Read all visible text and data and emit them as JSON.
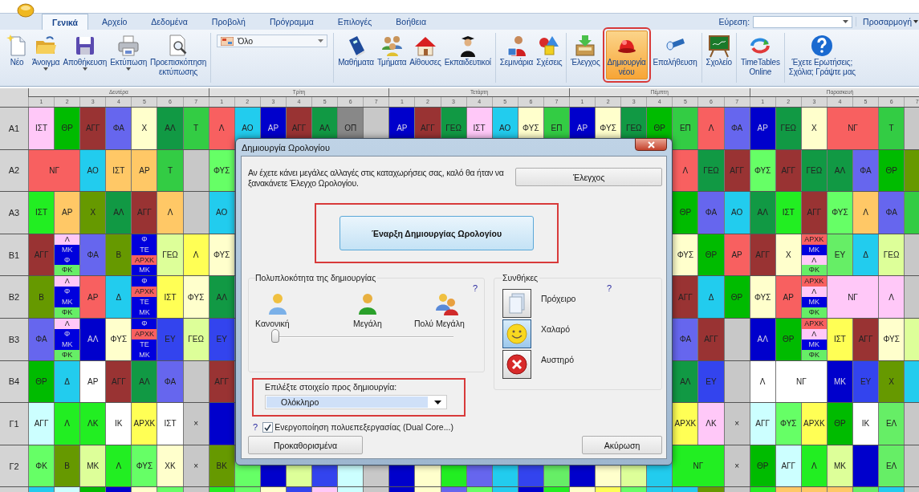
{
  "tabs": [
    {
      "label": "Γενικά",
      "selected": true
    },
    {
      "label": "Αρχείο",
      "selected": false
    },
    {
      "label": "Δεδομένα",
      "selected": false
    },
    {
      "label": "Προβολή",
      "selected": false
    },
    {
      "label": "Πρόγραμμα",
      "selected": false
    },
    {
      "label": "Επιλογές",
      "selected": false
    },
    {
      "label": "Βοήθεια",
      "selected": false
    }
  ],
  "search": {
    "label": "Εύρεση:"
  },
  "customize": {
    "label": "Προσαρμογή"
  },
  "ribbon": {
    "groups": [
      {
        "kind": "buttons",
        "buttons": [
          {
            "lines": [
              "Νέο"
            ],
            "menu": false,
            "highlighted": false
          },
          {
            "lines": [
              "Άνοιγμα"
            ],
            "menu": true,
            "highlighted": false
          },
          {
            "lines": [
              "Αποθήκευση"
            ],
            "menu": true,
            "highlighted": false
          },
          {
            "lines": [
              "Εκτύπωση"
            ],
            "menu": true,
            "highlighted": false
          },
          {
            "lines": [
              "Προεπισκόπηση",
              "εκτύπωσης"
            ],
            "menu": false,
            "highlighted": false
          }
        ]
      },
      {
        "kind": "combo",
        "value": "Όλο"
      },
      {
        "kind": "buttons",
        "buttons": [
          {
            "lines": [
              "Μαθήματα"
            ],
            "menu": false,
            "highlighted": false
          },
          {
            "lines": [
              "Τμήματα"
            ],
            "menu": false,
            "highlighted": false
          },
          {
            "lines": [
              "Αίθουσες"
            ],
            "menu": false,
            "highlighted": false
          },
          {
            "lines": [
              "Εκπαιδευτικοί"
            ],
            "menu": false,
            "highlighted": false
          }
        ]
      },
      {
        "kind": "buttons",
        "buttons": [
          {
            "lines": [
              "Σεμινάρια"
            ],
            "menu": false,
            "highlighted": false
          },
          {
            "lines": [
              "Σχέσεις"
            ],
            "menu": false,
            "highlighted": false
          }
        ]
      },
      {
        "kind": "buttons",
        "buttons": [
          {
            "lines": [
              "Έλεγχος"
            ],
            "menu": false,
            "highlighted": false
          },
          {
            "lines": [
              "Δημιουργία",
              "νέου"
            ],
            "menu": false,
            "highlighted": true
          },
          {
            "lines": [
              "Επαλήθευση"
            ],
            "menu": false,
            "highlighted": false
          }
        ]
      },
      {
        "kind": "buttons",
        "buttons": [
          {
            "lines": [
              "Σχολείο"
            ],
            "menu": false,
            "highlighted": false
          }
        ]
      },
      {
        "kind": "buttons",
        "buttons": [
          {
            "lines": [
              "TimeTables",
              "Online"
            ],
            "menu": false,
            "highlighted": false
          }
        ]
      },
      {
        "kind": "buttons",
        "buttons": [
          {
            "lines": [
              "Έχετε Ερωτήσεις;",
              "Σχόλια; Γράψτε μας"
            ],
            "menu": false,
            "highlighted": false
          }
        ]
      }
    ]
  },
  "timetable": {
    "days": [
      {
        "name": "Δευτέρα",
        "periods": [
          "1",
          "2",
          "3",
          "4",
          "5",
          "6",
          "7"
        ]
      },
      {
        "name": "Τρίτη",
        "periods": [
          "1",
          "2",
          "3",
          "4",
          "5",
          "6",
          "7"
        ]
      },
      {
        "name": "Τετάρτη",
        "periods": [
          "1",
          "2",
          "3",
          "4",
          "5",
          "6",
          "7"
        ]
      },
      {
        "name": "Πέμπτη",
        "periods": [
          "1",
          "2",
          "3",
          "4",
          "5",
          "6",
          "7"
        ]
      },
      {
        "name": "Παρασκευή",
        "periods": [
          "1",
          "2",
          "3",
          "4",
          "5",
          "6",
          "7"
        ]
      }
    ],
    "rows": [
      {
        "label": "Α1",
        "cells": [
          {
            "text": "ΙΣΤ",
            "color": "#ffc8f8"
          },
          {
            "text": "ΘΡ",
            "color": "#00bb00"
          },
          {
            "text": "ΑΓΓ",
            "color": "#993333"
          },
          {
            "text": "ΦΑ",
            "color": "#6666ee"
          },
          {
            "text": "Χ",
            "color": "#ffffcc"
          },
          {
            "text": "ΑΛ",
            "color": "#119944"
          },
          {
            "text": "Τ",
            "color": "#33cc44"
          },
          {
            "text": "Λ",
            "color": "#f86060"
          },
          {
            "text": "ΑΟ",
            "color": "#22ccee"
          },
          {
            "text": "ΑΡ",
            "color": "#0000cc"
          },
          {
            "text": "ΑΓΓ",
            "color": "#993333"
          },
          {
            "text": "ΑΛ",
            "color": "#119944"
          },
          {
            "text": "ΟΠ",
            "color": "#888888"
          },
          {
            "color": "#c8c8c8"
          },
          {
            "text": "ΑΡ",
            "color": "#0000cc"
          },
          {
            "text": "ΑΓΓ",
            "color": "#993333"
          },
          {
            "text": "ΓΕΩ",
            "color": "#119944"
          },
          {
            "text": "ΙΣΤ",
            "color": "#ffc8f8"
          },
          {
            "text": "ΑΟ",
            "color": "#22ccee"
          },
          {
            "text": "ΦΥΣ",
            "color": "#ffffcc"
          },
          {
            "text": "ΕΠ",
            "color": "#33cc44"
          },
          {
            "text": "ΑΡ",
            "color": "#0000cc"
          },
          {
            "text": "ΦΥΣ",
            "color": "#ffffcc"
          },
          {
            "text": "ΓΕΩ",
            "color": "#119944"
          },
          {
            "text": "ΘΡ",
            "color": "#00bb00"
          },
          {
            "text": "ΕΠ",
            "color": "#33cc44"
          },
          {
            "text": "Λ",
            "color": "#f86060"
          },
          {
            "text": "ΦΑ",
            "color": "#6666ee"
          },
          {
            "text": "ΑΡ",
            "color": "#0000cc"
          },
          {
            "text": "ΓΕΩ",
            "color": "#119944"
          },
          {
            "text": "Χ",
            "color": "#ffffcc"
          },
          {
            "text": "ΝΓ",
            "color": "#f86060"
          },
          "",
          {
            "text": "Τ",
            "color": "#33cc44"
          },
          {
            "color": "#c8c8c8"
          }
        ]
      },
      {
        "label": "Α2",
        "cells": [
          {
            "text": "ΝΓ",
            "color": "#f86060"
          },
          "",
          {
            "text": "ΑΟ",
            "color": "#22ccee"
          },
          {
            "text": "ΙΣΤ",
            "color": "#ffc866"
          },
          {
            "text": "ΑΡ",
            "color": "#ffc866"
          },
          {
            "text": "Τ",
            "color": "#33cc44"
          },
          {
            "color": "#c8c8c8"
          },
          {
            "text": "ΦΥΣ",
            "color": "#66ff66"
          },
          null,
          null,
          null,
          null,
          null,
          null,
          null,
          null,
          null,
          null,
          null,
          null,
          null,
          null,
          null,
          null,
          null,
          {
            "text": "Λ",
            "color": "#f86060"
          },
          {
            "text": "ΓΕΩ",
            "color": "#119944"
          },
          {
            "text": "ΑΓΓ",
            "color": "#993333"
          },
          {
            "text": "ΦΥΣ",
            "color": "#66ff66"
          },
          {
            "text": "ΑΓΓ",
            "color": "#993333"
          },
          {
            "text": "ΓΕΩ",
            "color": "#119944"
          },
          {
            "text": "ΑΛ",
            "color": "#119944"
          },
          {
            "text": "ΦΑ",
            "color": "#6666ee"
          },
          {
            "text": "ΘΡ",
            "color": "#00bb00"
          },
          {
            "color": "#669900"
          }
        ]
      },
      {
        "label": "Α3",
        "cells": [
          {
            "text": "ΙΣΤ",
            "color": "#22ee22"
          },
          {
            "text": "ΑΡ",
            "color": "#ffc866"
          },
          {
            "text": "Χ",
            "color": "#669900"
          },
          {
            "text": "ΑΛ",
            "color": "#119944"
          },
          {
            "text": "ΑΓΓ",
            "color": "#993333"
          },
          {
            "text": "Λ",
            "color": "#ffc866"
          },
          {
            "color": "#c8c8c8"
          },
          {
            "text": "ΑΟ",
            "color": "#22ccee"
          },
          null,
          null,
          null,
          null,
          null,
          null,
          null,
          null,
          null,
          null,
          null,
          null,
          null,
          null,
          null,
          null,
          null,
          {
            "text": "ΘΡ",
            "color": "#00bb00"
          },
          {
            "text": "ΦΑ",
            "color": "#6666ee"
          },
          {
            "text": "ΑΟ",
            "color": "#22ccee"
          },
          {
            "text": "ΑΛ",
            "color": "#119944"
          },
          {
            "text": "ΙΣΤ",
            "color": "#22ee22"
          },
          {
            "text": "ΑΓΓ",
            "color": "#993333"
          },
          {
            "text": "ΦΥΣ",
            "color": "#66ff66"
          },
          {
            "text": "Λ",
            "color": "#ffc866"
          },
          {
            "text": "ΦΑ",
            "color": "#6666ee"
          },
          {
            "color": "#33cc44"
          }
        ]
      },
      {
        "label": "Β1",
        "cells": [
          {
            "text": "ΑΓΓ",
            "color": "#993333"
          },
          {
            "parts": [
              {
                "text": "Λ",
                "color": "#ffc8f8"
              },
              {
                "text": "ΜΚ",
                "color": "#0000dd"
              },
              {
                "text": "Φ",
                "color": "#0000dd"
              },
              {
                "text": "ΦΚ",
                "color": "#66ee66"
              }
            ]
          },
          {
            "text": "ΦΑ",
            "color": "#6666ee"
          },
          {
            "text": "Β",
            "color": "#669900"
          },
          {
            "parts": [
              {
                "text": "Φ",
                "color": "#0000dd"
              },
              {
                "text": "ΤΕ",
                "color": "#0000dd"
              },
              {
                "text": "ΑΡΧΚ",
                "color": "#f86060"
              },
              {
                "text": "ΜΚ",
                "color": "#0000dd"
              }
            ]
          },
          {
            "text": "ΓΕΩ",
            "color": "#ddff99"
          },
          {
            "text": "Λ",
            "color": "#ffff55"
          },
          {
            "text": "ΦΥΣ",
            "color": "#ffffcc"
          },
          null,
          null,
          null,
          null,
          null,
          null,
          null,
          null,
          null,
          null,
          null,
          null,
          null,
          null,
          null,
          null,
          null,
          {
            "text": "ΦΥΣ",
            "color": "#ffffcc"
          },
          {
            "text": "ΘΡ",
            "color": "#00bb00"
          },
          {
            "text": "ΑΡ",
            "color": "#f86060"
          },
          {
            "text": "ΑΓΓ",
            "color": "#993333"
          },
          {
            "text": "Χ",
            "color": "#ffffcc"
          },
          {
            "parts": [
              {
                "text": "ΑΡΧΚ",
                "color": "#f86060"
              },
              {
                "text": "ΜΚ",
                "color": "#0000dd"
              },
              {
                "text": "Λ",
                "color": "#ffc8f8"
              },
              {
                "text": "ΦΚ",
                "color": "#66ee66"
              }
            ]
          },
          {
            "text": "ΕΥ",
            "color": "#66ee66"
          },
          {
            "text": "Δ",
            "color": "#22ccee"
          },
          {
            "text": "ΓΕΩ",
            "color": "#ddff99"
          },
          {
            "color": "#c8c8c8"
          }
        ]
      },
      {
        "label": "Β2",
        "cells": [
          {
            "text": "Β",
            "color": "#669900"
          },
          {
            "parts": [
              {
                "text": "Λ",
                "color": "#ffc8f8"
              },
              {
                "text": "Φ",
                "color": "#0000dd"
              },
              {
                "text": "ΜΚ",
                "color": "#0000dd"
              },
              {
                "text": "ΦΚ",
                "color": "#66ee66"
              }
            ]
          },
          {
            "text": "ΑΡ",
            "color": "#f86060"
          },
          {
            "text": "Δ",
            "color": "#22ccee"
          },
          {
            "parts": [
              {
                "text": "Φ",
                "color": "#0000dd"
              },
              {
                "text": "ΑΡΧΚ",
                "color": "#f86060"
              },
              {
                "text": "ΤΕ",
                "color": "#0000dd"
              },
              {
                "text": "ΜΚ",
                "color": "#0000dd"
              }
            ]
          },
          {
            "text": "ΙΣΤ",
            "color": "#ffff55"
          },
          {
            "text": "ΦΥΣ",
            "color": "#ffffcc"
          },
          {
            "text": "ΑΛ",
            "color": "#119944"
          },
          null,
          null,
          null,
          null,
          null,
          null,
          null,
          null,
          null,
          null,
          null,
          null,
          null,
          null,
          null,
          null,
          null,
          {
            "text": "ΑΓΓ",
            "color": "#993333"
          },
          {
            "text": "Δ",
            "color": "#22ccee"
          },
          {
            "text": "ΘΡ",
            "color": "#00bb00"
          },
          {
            "text": "ΦΥΣ",
            "color": "#ffffcc"
          },
          {
            "text": "ΑΡ",
            "color": "#f86060"
          },
          {
            "parts": [
              {
                "text": "ΑΡΧΚ",
                "color": "#f86060"
              },
              {
                "text": "Λ",
                "color": "#ffc8f8"
              },
              {
                "text": "ΜΚ",
                "color": "#0000dd"
              },
              {
                "text": "ΦΚ",
                "color": "#66ee66"
              }
            ]
          },
          {
            "text": "ΝΓ",
            "color": "#ffc8f8"
          },
          "",
          {
            "text": "Λ",
            "color": "#ffc8f8"
          },
          {
            "color": "#c8c8c8"
          }
        ]
      },
      {
        "label": "Β3",
        "cells": [
          {
            "text": "ΦΑ",
            "color": "#6666ee"
          },
          {
            "parts": [
              {
                "text": "Λ",
                "color": "#ffc8f8"
              },
              {
                "text": "Φ",
                "color": "#0000dd"
              },
              {
                "text": "ΜΚ",
                "color": "#0000dd"
              },
              {
                "text": "ΦΚ",
                "color": "#66ee66"
              }
            ]
          },
          {
            "text": "ΑΛ",
            "color": "#0000cc"
          },
          {
            "text": "ΦΥΣ",
            "color": "#ffffcc"
          },
          {
            "parts": [
              {
                "text": "Φ",
                "color": "#0000dd"
              },
              {
                "text": "ΑΡΧΚ",
                "color": "#f86060"
              },
              {
                "text": "ΤΕ",
                "color": "#0000dd"
              },
              {
                "text": "ΜΚ",
                "color": "#0000dd"
              }
            ]
          },
          {
            "text": "ΕΥ",
            "color": "#3344ee"
          },
          {
            "text": "ΓΕΩ",
            "color": "#ddff99"
          },
          {
            "text": "ΕΥ",
            "color": "#3344ee"
          },
          null,
          null,
          null,
          null,
          null,
          null,
          null,
          null,
          null,
          null,
          null,
          null,
          null,
          null,
          null,
          null,
          null,
          {
            "text": "ΦΑ",
            "color": "#6666ee"
          },
          {
            "text": "ΑΓΓ",
            "color": "#993333"
          },
          {
            "color": "#c8c8c8"
          },
          {
            "text": "ΑΛ",
            "color": "#0000cc"
          },
          {
            "text": "ΘΡ",
            "color": "#00bb00"
          },
          {
            "parts": [
              {
                "text": "ΑΡΧΚ",
                "color": "#f86060"
              },
              {
                "text": "Λ",
                "color": "#ffc8f8"
              },
              {
                "text": "ΜΚ",
                "color": "#0000dd"
              },
              {
                "text": "ΦΚ",
                "color": "#66ee66"
              }
            ]
          },
          {
            "text": "ΙΣΤ",
            "color": "#ffff55"
          },
          {
            "text": "ΑΓΓ",
            "color": "#993333"
          },
          {
            "text": "ΦΥΣ",
            "color": "#ffffcc"
          },
          {
            "color": "#ddff99"
          }
        ]
      },
      {
        "label": "Β4",
        "cells": [
          {
            "text": "ΘΡ",
            "color": "#00bb00"
          },
          {
            "text": "Δ",
            "color": "#22ccee"
          },
          {
            "text": "ΑΡ",
            "color": "#ffffff"
          },
          {
            "text": "ΑΓΓ",
            "color": "#993333"
          },
          {
            "text": "ΑΛ",
            "color": "#119944"
          },
          {
            "text": "ΦΑ",
            "color": "#6666ee"
          },
          {
            "color": "#c8c8c8"
          },
          {
            "text": "ΑΓΓ",
            "color": "#993333"
          },
          null,
          null,
          null,
          null,
          null,
          null,
          null,
          null,
          null,
          null,
          null,
          null,
          null,
          null,
          null,
          null,
          null,
          {
            "text": "ΑΛ",
            "color": "#119944"
          },
          {
            "text": "ΕΥ",
            "color": "#3344ee"
          },
          {
            "color": "#c8c8c8"
          },
          {
            "text": "Λ",
            "color": "#ffffff"
          },
          {
            "text": "ΝΓ",
            "color": "#ffffff"
          },
          "",
          {
            "text": "ΜΚ",
            "color": "#0000cc"
          },
          {
            "text": "ΕΥ",
            "color": "#3344ee"
          },
          {
            "text": "Χ",
            "color": "#669900"
          },
          {
            "color": "#22ccee"
          }
        ]
      },
      {
        "label": "Γ1",
        "cells": [
          {
            "text": "ΑΓΓ",
            "color": "#ccffff"
          },
          {
            "text": "Λ",
            "color": "#22ee22"
          },
          {
            "text": "ΛΚ",
            "color": "#22ee22"
          },
          {
            "text": "ΙΚ",
            "color": "#ffffff"
          },
          {
            "text": "ΑΡΧΚ",
            "color": "#ffff55"
          },
          {
            "text": "ΙΣΤ",
            "color": "#ffffff"
          },
          {
            "text": "×",
            "color": "#c8c8c8"
          },
          {
            "color": "#0000cc"
          },
          null,
          null,
          null,
          null,
          null,
          null,
          null,
          null,
          null,
          null,
          null,
          null,
          null,
          null,
          null,
          null,
          null,
          {
            "text": "ΑΡΧΚ",
            "color": "#ffff55"
          },
          {
            "text": "ΛΚ",
            "color": "#ffc8f8"
          },
          {
            "text": "×",
            "color": "#c8c8c8"
          },
          {
            "text": "ΑΓΓ",
            "color": "#ccffff"
          },
          {
            "text": "ΦΥΣ",
            "color": "#66ff66"
          },
          {
            "text": "ΑΡΧΚ",
            "color": "#ffff55"
          },
          {
            "text": "ΘΡ",
            "color": "#00bb00"
          },
          {
            "text": "ΙΚ",
            "color": "#ffffff"
          },
          {
            "text": "ΕΛ",
            "color": "#66ee66"
          },
          {
            "color": "#c8c8c8"
          }
        ]
      },
      {
        "label": "Γ2",
        "cells": [
          {
            "text": "ΦΚ",
            "color": "#66ff66"
          },
          {
            "text": "Β",
            "color": "#669900"
          },
          {
            "text": "ΜΚ",
            "color": "#ddff99"
          },
          {
            "text": "Λ",
            "color": "#22ee22"
          },
          {
            "text": "ΦΥΣ",
            "color": "#66ff66"
          },
          {
            "text": "ΧΚ",
            "color": "#ffffcc"
          },
          {
            "text": "×",
            "color": "#c8c8c8"
          },
          {
            "text": "ΒΚ",
            "color": "#669900"
          },
          {
            "color": "#66ff66"
          },
          {
            "color": "#0000cc"
          },
          {
            "color": "#ddff99"
          },
          {
            "color": "#3344ee"
          },
          {
            "color": "#ccffff"
          },
          {
            "color": "#c8c8c8"
          },
          {
            "color": "#0000cc"
          },
          {
            "color": "#ffffcc"
          },
          {
            "color": "#22ee22"
          },
          {
            "color": "#6666ee"
          },
          {
            "color": "#22ccee"
          },
          {
            "color": "#3344ee"
          },
          {
            "color": "#66ee66"
          },
          {
            "color": "#0000cc"
          },
          {
            "color": "#ffffcc"
          },
          {
            "color": "#ddff99"
          },
          {
            "color": "#22ccee"
          },
          {
            "text": "ΝΓ",
            "color": "#22ee22"
          },
          "",
          {
            "text": "×",
            "color": "#c8c8c8"
          },
          {
            "text": "ΘΡ",
            "color": "#00bb00"
          },
          {
            "text": "ΑΓΓ",
            "color": "#ccffff"
          },
          {
            "text": "Λ",
            "color": "#22ee22"
          },
          {
            "text": "ΜΚ",
            "color": "#ddff99"
          },
          {
            "color": "#0000cc"
          },
          {
            "text": "ΕΛ",
            "color": "#66ee66"
          },
          {
            "color": "#c8c8c8"
          }
        ]
      },
      {
        "cells": [
          {
            "color": "#22ccee"
          },
          {
            "color": "#ccffff"
          },
          {
            "color": "#00bb00"
          },
          {
            "color": "#0000cc"
          },
          {
            "color": "#ffffcc"
          },
          {
            "color": "#66ff66"
          },
          {
            "color": "#c8c8c8"
          },
          {
            "color": "#22ee22"
          },
          {
            "color": "#66ff66"
          },
          {
            "color": "#ffffcc"
          },
          {
            "color": "#3344ee"
          },
          {
            "color": "#ffc8f8"
          },
          {
            "color": "#ccffff"
          },
          {
            "color": "#c8c8c8"
          },
          {
            "color": "#0000cc"
          },
          {
            "color": "#ffffcc"
          },
          {
            "color": "#6666ee"
          },
          {
            "color": "#66ff66"
          },
          {
            "color": "#22ccee"
          },
          {
            "color": "#0000cc"
          },
          {
            "color": "#22ee22"
          },
          {
            "color": "#ffffcc"
          },
          {
            "color": "#ffff55"
          },
          {
            "color": "#66ff66"
          },
          {
            "color": "#22ccee"
          },
          {
            "color": "#22ccee"
          },
          {
            "color": "#669900"
          },
          {
            "color": "#c8c8c8"
          },
          {
            "color": "#22ee22"
          },
          {
            "color": "#ffc866"
          },
          {
            "color": "#ffc866"
          },
          {
            "color": "#ffc866"
          },
          {
            "color": "#66ee66"
          },
          {
            "color": "#22ccee"
          },
          {
            "color": "#c8c8c8"
          }
        ]
      }
    ]
  },
  "dialog": {
    "title": "Δημιουργία Ωρολογίου",
    "message": "Αν έχετε κάνει μεγάλες αλλαγές στις καταχωρήσεις σας, καλό θα ήταν να ξανακάνετε Έλεγχο Ωρολογίου.",
    "check_button": "Έλεγχος",
    "start_button": {
      "label": "Έναρξη Δημιουργίας Ωρολογίου",
      "highlighted": true
    },
    "complexity": {
      "title": "Πολυπλοκότητα της δημιουργίας",
      "help": "?",
      "options": [
        "Κανονική",
        "Μεγάλη",
        "Πολύ Μεγάλη"
      ],
      "level": 0
    },
    "conditions": {
      "title": "Συνθήκες",
      "help": "?",
      "options": [
        {
          "label": "Πρόχειρο",
          "selected": false
        },
        {
          "label": "Χαλαρό",
          "selected": true
        },
        {
          "label": "Αυστηρό",
          "selected": false
        }
      ]
    },
    "target": {
      "label": "Επιλέξτε στοιχείο προς δημιουργία:",
      "value": "Ολόκληρο",
      "highlighted": true
    },
    "multithreading": {
      "help": "?",
      "label": "Ενεργοποίηση πολυεπεξεργασίας (Dual Core...)",
      "checked": true
    },
    "defaults_button": "Προκαθορισμένα",
    "cancel_button": "Ακύρωση"
  }
}
